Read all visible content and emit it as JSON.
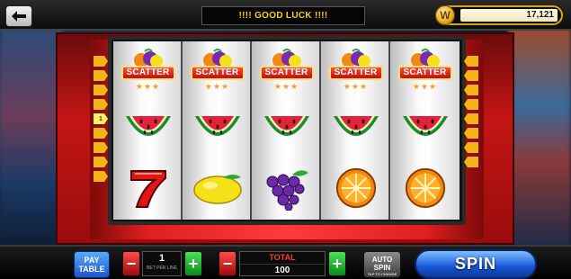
{
  "header": {
    "message": "!!!! GOOD LUCK !!!!",
    "coin_symbol": "W",
    "balance": "17,121"
  },
  "reels": [
    [
      "scatter",
      "watermelon",
      "seven"
    ],
    [
      "scatter",
      "watermelon",
      "lemon"
    ],
    [
      "scatter",
      "watermelon",
      "grapes"
    ],
    [
      "scatter",
      "watermelon",
      "orange"
    ],
    [
      "scatter",
      "watermelon",
      "orange"
    ]
  ],
  "scatter_label": "SCATTER",
  "paylines": {
    "active": 1
  },
  "controls": {
    "paytable_label_1": "PAY",
    "paytable_label_2": "TABLE",
    "bet_per_line": "1",
    "bet_per_line_label": "BET PER LINE",
    "total_label": "TOTAL",
    "total_value": "100",
    "auto_spin_1": "AUTO",
    "auto_spin_2": "SPIN",
    "auto_spin_sub": "TAP TO CHANGE",
    "spin_label": "SPIN",
    "minus": "−",
    "plus": "+"
  },
  "colors": {
    "cabinet_red": "#c41515",
    "accent_gold": "#f6d21b",
    "spin_blue": "#1756d8"
  }
}
